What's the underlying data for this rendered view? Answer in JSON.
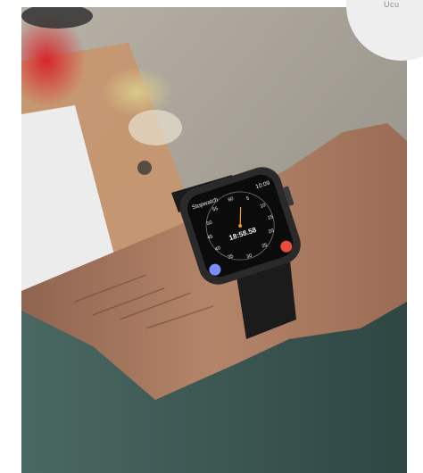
{
  "watch": {
    "app_label": "Stopwatch",
    "clock_time": "10:09",
    "elapsed": "18:58.58",
    "dial_numbers": [
      "60",
      "5",
      "10",
      "15",
      "20",
      "25",
      "30",
      "35",
      "40",
      "45",
      "50",
      "55"
    ],
    "colors": {
      "app_label": "#f39c12",
      "lap_button": "#7c8cff",
      "stop_button": "#e74c3c",
      "screen": "#0b0b0b",
      "case": "#2a2a2a"
    }
  },
  "corner_badge": {
    "text": "Ucu"
  },
  "colors": {
    "sleeve": "#3f5a56",
    "skin": "#a87a60",
    "background": "#a9a49b"
  }
}
